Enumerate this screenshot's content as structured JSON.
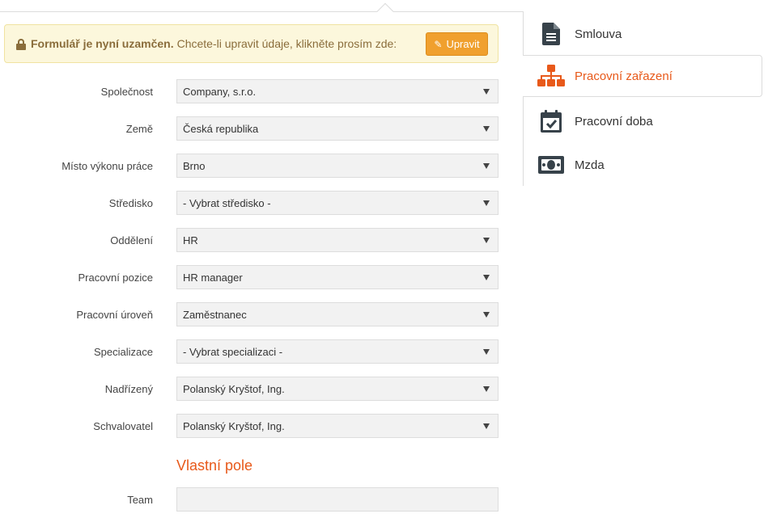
{
  "alert": {
    "bold_text": "Formulář je nyní uzamčen.",
    "text": "Chcete-li upravit údaje, klikněte prosím zde:",
    "button_label": "Upravit"
  },
  "form": {
    "fields": [
      {
        "label": "Společnost",
        "value": "Company, s.r.o."
      },
      {
        "label": "Země",
        "value": "Česká republika"
      },
      {
        "label": "Místo výkonu práce",
        "value": "Brno"
      },
      {
        "label": "Středisko",
        "value": "- Vybrat středisko -"
      },
      {
        "label": "Oddělení",
        "value": "HR"
      },
      {
        "label": "Pracovní pozice",
        "value": "HR manager"
      },
      {
        "label": "Pracovní úroveň",
        "value": "Zaměstnanec"
      },
      {
        "label": "Specializace",
        "value": "- Vybrat specializaci -"
      },
      {
        "label": "Nadřízený",
        "value": "Polanský Kryštof, Ing."
      },
      {
        "label": "Schvalovatel",
        "value": "Polanský Kryštof, Ing."
      }
    ],
    "custom_section_title": "Vlastní pole",
    "custom_fields": [
      {
        "label": "Team",
        "value": ""
      }
    ]
  },
  "nav": {
    "items": [
      {
        "label": "Smlouva",
        "icon": "document-icon",
        "active": false
      },
      {
        "label": "Pracovní zařazení",
        "icon": "org-chart-icon",
        "active": true
      },
      {
        "label": "Pracovní doba",
        "icon": "calendar-check-icon",
        "active": false
      },
      {
        "label": "Mzda",
        "icon": "money-icon",
        "active": false
      }
    ]
  },
  "colors": {
    "accent": "#e8591a",
    "icon_dark": "#37424a",
    "button": "#f0a02e",
    "alert_bg": "#fcf7dc",
    "alert_text": "#8a6d3b"
  }
}
